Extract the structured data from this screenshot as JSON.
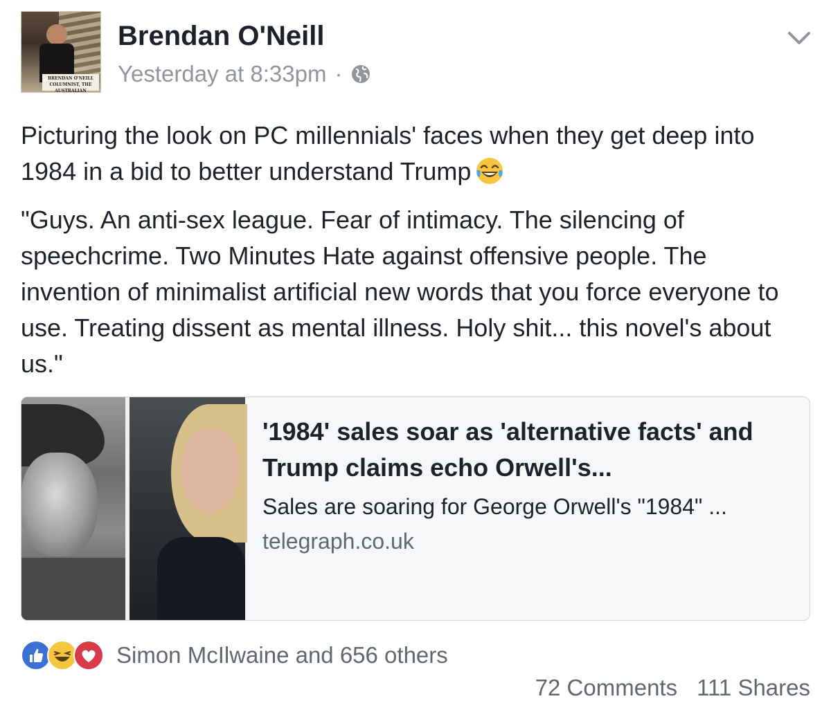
{
  "post": {
    "author": "Brendan O'Neill",
    "timestamp": "Yesterday at 8:33pm",
    "separator": "·",
    "privacy_icon": "globe-icon",
    "options_icon": "chevron-down-icon",
    "avatar": {
      "caption_line1": "BRENDAN O'NEILL",
      "caption_line2": "COLUMNIST, THE AUSTRALIAN"
    },
    "text_para1": "Picturing the look on PC millennials' faces when they get deep into 1984 in a bid to better understand Trump",
    "text_para1_emoji": "tears-of-joy-emoji",
    "text_para2": "\"Guys. An anti-sex league. Fear of intimacy. The silencing of speechcrime. Two Minutes Hate against offensive people. The invention of minimalist artificial new words that you force everyone to use. Treating dissent as mental illness. Holy shit... this novel's about us.\""
  },
  "link_card": {
    "title": "'1984' sales soar as 'alternative facts' and Trump claims echo Orwell's...",
    "description": "Sales are soaring for George Orwell's \"1984\" ...",
    "domain": "telegraph.co.uk"
  },
  "reactions": {
    "icons": [
      "like-icon",
      "haha-icon",
      "love-icon"
    ],
    "summary": "Simon McIlwaine and 656 others"
  },
  "counts": {
    "comments": "72 Comments",
    "shares": "111 Shares"
  },
  "colors": {
    "text_primary": "#1d2129",
    "text_secondary": "#90949c",
    "like_blue": "#3b6fd4",
    "haha_yellow": "#f7c63f",
    "love_red": "#d93a4a"
  }
}
